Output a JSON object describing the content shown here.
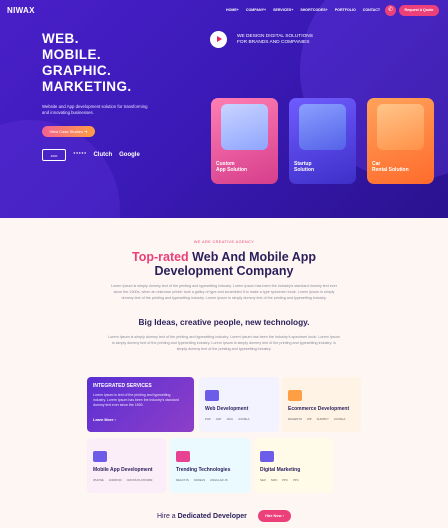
{
  "brand": {
    "logo": "NIWAX"
  },
  "nav": {
    "links": [
      "HOME+",
      "COMPANY+",
      "SERVICES+",
      "SHORTCODES+",
      "PORTFOLIO",
      "CONTACT"
    ],
    "quote_label": "Request A Quote"
  },
  "hero": {
    "title_lines": [
      "WEB.",
      "MOBILE.",
      "GRAPHIC.",
      "MARKETING."
    ],
    "description": "Website and App development solution for transforming and innovating businesses.",
    "case_button": "View Case Studies",
    "badges": [
      "2020",
      "Clutch",
      "Google"
    ],
    "design_text_1": "WE DESIGN DIGITAL SOLUTIONS",
    "design_text_2": "FOR BRANDS AND COMPANIES",
    "cards": [
      {
        "label_1": "Custom",
        "label_2": "App Solution",
        "color": "#ff5fa2"
      },
      {
        "label_1": "Startup",
        "label_2": "Solution",
        "color": "#5b4de8"
      },
      {
        "label_1": "Car",
        "label_2": "Rental Solution",
        "color": "#ff8a3d"
      }
    ]
  },
  "about": {
    "eyebrow": "WE ARE CREATIVE AGENCY",
    "title_accent": "Top-rated",
    "title_rest": " Web And Mobile App",
    "title_line2": "Development Company",
    "para_1": "Lorem Ipsum is simply dummy text of the printing and typesetting industry. Lorem Ipsum has been the industry's standard dummy text ever since the 1500s, when an unknown printer took a galley of type and scrambled it to make a type specimen book. Lorem Ipsum is simply dummy text of the printing and typesetting industry. Lorem Ipsum is simply dummy text of the printing and typesetting industry.",
    "big_ideas": "Big Ideas, creative people, new technology.",
    "para_2": "Lorem Ipsum is simply dummy text of the printing and typesetting industry. Lorem Ipsum has been the industry's specimen book. Lorem Ipsum is simply dummy text of the printing and typesetting industry. Lorem Ipsum is simply dummy text of the printing and typesetting industry. is simply dummy text of the printing and typesetting industry."
  },
  "services": {
    "featured": {
      "title": "INTEGRATED SERVICES",
      "desc": "Lorem Ipsum is text of the printing and typesetting industry. Lorem Ipsum has been the industry's standard dummy text ever since the 1500.",
      "link": "Learn More"
    },
    "cards": [
      {
        "title": "Web Development",
        "tags": [
          "PHP",
          "ASP",
          "JAVA",
          "JOOMLA"
        ],
        "bg": "#f3f2ff",
        "icon": "#6c5ce7"
      },
      {
        "title": "Ecommerce Development",
        "tags": [
          "MAGENTO",
          "WP",
          "SHOPIFY",
          "JOOMLA"
        ],
        "bg": "#fff3e6",
        "icon": "#ff9f43"
      },
      {
        "title": "Mobile App Development",
        "tags": [
          "IPHONE",
          "ANDROID",
          "CROSS PLATFORM"
        ],
        "bg": "#fbeef9",
        "icon": "#6c5ce7"
      },
      {
        "title": "Trending Technologies",
        "tags": [
          "REACTJS",
          "NODEJS",
          "ANGULAR JS"
        ],
        "bg": "#eafaff",
        "icon": "#e84393"
      },
      {
        "title": "Digital Marketing",
        "tags": [
          "SEO",
          "SMO",
          "PPC",
          "PPC"
        ],
        "bg": "#fffbe8",
        "icon": "#6c5ce7"
      }
    ]
  },
  "hire": {
    "text_prefix": "Hire a ",
    "text_bold": "Dedicated Developer",
    "button": "Hire Now"
  }
}
